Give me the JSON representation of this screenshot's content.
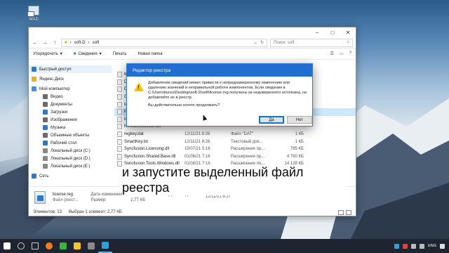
{
  "desktop": {
    "icon_label": "WAD"
  },
  "explorer": {
    "address": {
      "path_segments": [
        "soft-D",
        "soft"
      ],
      "separator": "›"
    },
    "search": {
      "placeholder": "Поиск: soft"
    },
    "toolbar": {
      "organize": "Упорядочить",
      "share": "Сведения",
      "print": "Печать",
      "new_folder": "Новая папка"
    },
    "nav": [
      {
        "label": "Быстрый доступ",
        "level": 0,
        "color": "#2f78c8"
      },
      {
        "label": "Яндекс.Диск",
        "level": 0,
        "color": "#f0b400"
      },
      {
        "label": "Мой компьютер",
        "level": 0,
        "color": "#4a90d9"
      },
      {
        "label": "Видео",
        "level": 1,
        "color": "#6a6a6a"
      },
      {
        "label": "Документы",
        "level": 1,
        "color": "#6a6a6a"
      },
      {
        "label": "Загрузки",
        "level": 1,
        "color": "#2f78c8"
      },
      {
        "label": "Изображения",
        "level": 1,
        "color": "#6a6a6a"
      },
      {
        "label": "Музыка",
        "level": 1,
        "color": "#2f78c8"
      },
      {
        "label": "Объемные объекты",
        "level": 1,
        "color": "#6a6a6a"
      },
      {
        "label": "Рабочий стол",
        "level": 1,
        "color": "#2f78c8"
      },
      {
        "label": "Локальный диск (C:)",
        "level": 1,
        "color": "#888888"
      },
      {
        "label": "Локальный диск (D:)",
        "level": 1,
        "color": "#888888"
      },
      {
        "label": "Локальный диск (E:)",
        "level": 1,
        "color": "#888888"
      },
      {
        "label": "Сеть",
        "level": 0,
        "color": "#2f78c8"
      }
    ],
    "files": [
      {
        "name": "bu",
        "date": "",
        "type": "",
        "size": "",
        "selected": false
      },
      {
        "name": "Da",
        "date": "",
        "type": "",
        "size": "",
        "selected": false
      },
      {
        "name": "Dyr",
        "date": "",
        "type": "",
        "size": "",
        "selected": false
      },
      {
        "name": "Ge",
        "date": "",
        "type": "",
        "size": "",
        "selected": false
      },
      {
        "name": "id",
        "date": "",
        "type": "",
        "size": "",
        "selected": false
      },
      {
        "name": "lice",
        "date": "",
        "type": "",
        "size": "",
        "selected": true
      },
      {
        "name": "lice",
        "date": "",
        "type": "",
        "size": "",
        "selected": false
      },
      {
        "name": "Newtonsoft.Json.dll",
        "date": "",
        "type": "",
        "size": "",
        "selected": false
      },
      {
        "name": "regkey.dat",
        "date": "12/11/21 8:26",
        "type": "Файл \"DAT\"",
        "size": "1 КБ",
        "selected": false
      },
      {
        "name": "SmartKey.txt",
        "date": "12/11/21 8:26",
        "type": "Текстовый док...",
        "size": "1 КБ",
        "selected": false
      },
      {
        "name": "Syncfusion.Licensing.dll",
        "date": "15/07/21 5:16",
        "type": "Расширение пр...",
        "size": "785 КБ",
        "selected": false
      },
      {
        "name": "Syncfusion.Shared.Base.dll",
        "date": "01/08/21 7:16",
        "type": "Расширение пр...",
        "size": "4 760 КБ",
        "selected": false
      },
      {
        "name": "Syncfusion.Tools.Windows.dll",
        "date": "01/08/21 7:16",
        "type": "Расширение пр...",
        "size": "14 128 КБ",
        "selected": false
      }
    ],
    "details": {
      "name": "license.reg",
      "type": "Файл реест...",
      "modified_label": "Дата изменения:",
      "modified": "12/11/21 8:26",
      "size_label": "Размер:",
      "size": "2,77 КБ",
      "created_label": "Дата создания:",
      "created": "12/11/21 8:27"
    },
    "status": {
      "count": "Элементов: 13",
      "selected": "Выбран 1 элемент: 2,77 КБ"
    }
  },
  "dialog": {
    "title": "Редактор реестра",
    "message": "Добавление сведений может привести к непреднамеренному изменению или удалению значений и неправильной работе компонентов. Если сведения в C:\\Users\\kursu\\Desktop\\soft-D\\soft\\license.reg получены из недоверенного источника, не добавляйте их в реестр.",
    "question": "Вы действительно хотите продолжить?",
    "yes": "Да",
    "no": "Нет"
  },
  "caption": "и запустите выделенный файл реестра",
  "taskbar": {
    "icons": [
      {
        "name": "start-icon",
        "color": "#ffffff"
      },
      {
        "name": "search-icon",
        "color": "#cccccc"
      },
      {
        "name": "task-view-icon",
        "color": "#cccccc"
      },
      {
        "name": "firefox-icon",
        "color": "#ff7a1a"
      },
      {
        "name": "terminal-icon",
        "color": "#3cb043"
      },
      {
        "name": "explorer-icon",
        "color": "#f4c430"
      },
      {
        "name": "app-icon",
        "color": "#8a8a8a"
      },
      {
        "name": "regedit-icon",
        "color": "#2f9fd8"
      }
    ],
    "lang": "ENG"
  }
}
